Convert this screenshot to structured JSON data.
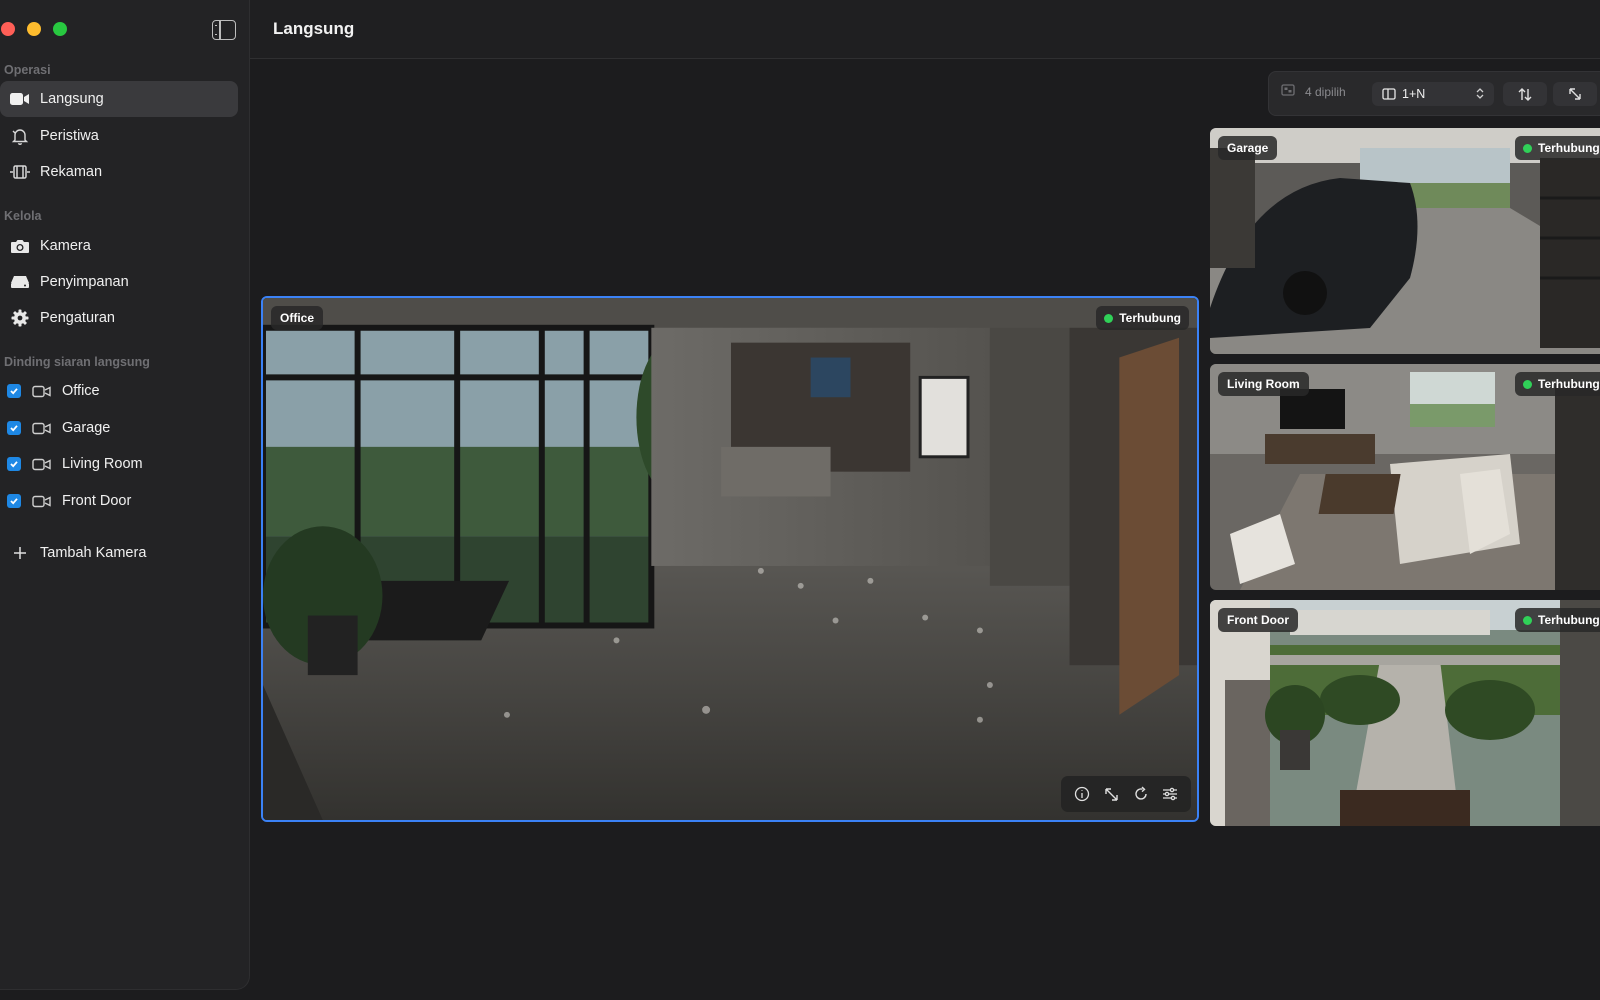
{
  "window": {
    "title": "Langsung"
  },
  "sidebar": {
    "sections": {
      "operations": "Operasi",
      "manage": "Kelola",
      "live_wall": "Dinding siaran langsung"
    },
    "operations_items": [
      {
        "label": "Langsung",
        "icon": "video-camera-icon",
        "active": true
      },
      {
        "label": "Peristiwa",
        "icon": "bell-icon",
        "active": false
      },
      {
        "label": "Rekaman",
        "icon": "film-icon",
        "active": false
      }
    ],
    "manage_items": [
      {
        "label": "Kamera",
        "icon": "camera-icon"
      },
      {
        "label": "Penyimpanan",
        "icon": "storage-icon"
      },
      {
        "label": "Pengaturan",
        "icon": "gear-icon"
      }
    ],
    "wall_items": [
      {
        "label": "Office",
        "checked": true
      },
      {
        "label": "Garage",
        "checked": true
      },
      {
        "label": "Living Room",
        "checked": true
      },
      {
        "label": "Front Door",
        "checked": true
      }
    ],
    "add_camera": "Tambah Kamera"
  },
  "toolbar": {
    "selected": "4 dipilih",
    "layout": "1+N",
    "icons": [
      "selection-icon",
      "layout-icon",
      "swap-icon",
      "expand-icon"
    ]
  },
  "cameras": {
    "main": {
      "name": "Office",
      "status": "Terhubung"
    },
    "side": [
      {
        "name": "Garage",
        "status": "Terhubung"
      },
      {
        "name": "Living Room",
        "status": "Terhubung"
      },
      {
        "name": "Front Door",
        "status": "Terhubung"
      }
    ]
  },
  "main_controls": [
    "info-icon",
    "fullscreen-icon",
    "refresh-icon",
    "settings-sliders-icon"
  ],
  "colors": {
    "accent": "#3b82f6",
    "connected": "#30d158",
    "checkbox": "#1e88e5"
  }
}
